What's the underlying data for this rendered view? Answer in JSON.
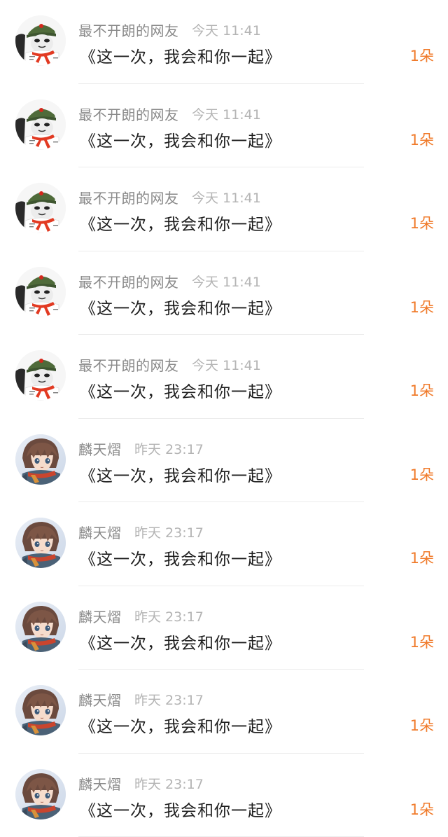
{
  "items": [
    {
      "avatar_icon": "panda-meme-soldier-icon",
      "username": "最不开朗的网友",
      "time": "今天 11:41",
      "message": "《这一次，我会和你一起》",
      "count": "1朵"
    },
    {
      "avatar_icon": "panda-meme-soldier-icon",
      "username": "最不开朗的网友",
      "time": "今天 11:41",
      "message": "《这一次，我会和你一起》",
      "count": "1朵"
    },
    {
      "avatar_icon": "panda-meme-soldier-icon",
      "username": "最不开朗的网友",
      "time": "今天 11:41",
      "message": "《这一次，我会和你一起》",
      "count": "1朵"
    },
    {
      "avatar_icon": "panda-meme-soldier-icon",
      "username": "最不开朗的网友",
      "time": "今天 11:41",
      "message": "《这一次，我会和你一起》",
      "count": "1朵"
    },
    {
      "avatar_icon": "panda-meme-soldier-icon",
      "username": "最不开朗的网友",
      "time": "今天 11:41",
      "message": "《这一次，我会和你一起》",
      "count": "1朵"
    },
    {
      "avatar_icon": "anime-boy-icon",
      "username": "麟天熠",
      "time": "昨天 23:17",
      "message": "《这一次，我会和你一起》",
      "count": "1朵"
    },
    {
      "avatar_icon": "anime-boy-icon",
      "username": "麟天熠",
      "time": "昨天 23:17",
      "message": "《这一次，我会和你一起》",
      "count": "1朵"
    },
    {
      "avatar_icon": "anime-boy-icon",
      "username": "麟天熠",
      "time": "昨天 23:17",
      "message": "《这一次，我会和你一起》",
      "count": "1朵"
    },
    {
      "avatar_icon": "anime-boy-icon",
      "username": "麟天熠",
      "time": "昨天 23:17",
      "message": "《这一次，我会和你一起》",
      "count": "1朵"
    },
    {
      "avatar_icon": "anime-boy-icon",
      "username": "麟天熠",
      "time": "昨天 23:17",
      "message": "《这一次，我会和你一起》",
      "count": "1朵"
    }
  ],
  "colors": {
    "count_accent": "#f07a2a",
    "name_gray": "#8a8a8a",
    "time_gray": "#b4b4b4",
    "message_text": "#1e1e1e"
  }
}
